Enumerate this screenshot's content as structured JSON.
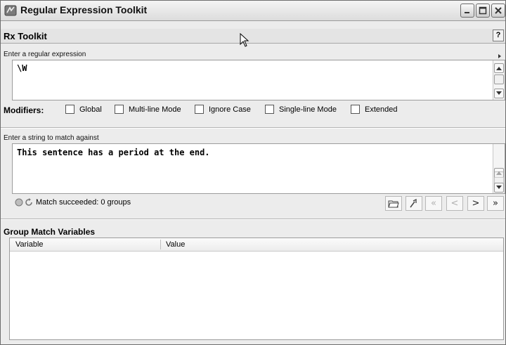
{
  "window": {
    "title": "Regular Expression Toolkit"
  },
  "toolkit": {
    "title": "Rx Toolkit",
    "help_label": "?"
  },
  "regex": {
    "label": "Enter a regular expression",
    "value": "\\W"
  },
  "modifiers": {
    "label": "Modifiers:",
    "items": [
      {
        "label": "Global",
        "checked": false
      },
      {
        "label": "Multi-line Mode",
        "checked": false
      },
      {
        "label": "Ignore Case",
        "checked": false
      },
      {
        "label": "Single-line Mode",
        "checked": false
      },
      {
        "label": "Extended",
        "checked": false
      }
    ]
  },
  "match_string": {
    "label": "Enter a string to match against",
    "value": "This sentence has a period at the end."
  },
  "status": {
    "text": "Match succeeded: 0 groups"
  },
  "toolbar": {
    "first": "«",
    "prev": "<",
    "next": ">",
    "last": "»"
  },
  "groups": {
    "title": "Group Match Variables",
    "columns": [
      "Variable",
      "Value"
    ]
  }
}
